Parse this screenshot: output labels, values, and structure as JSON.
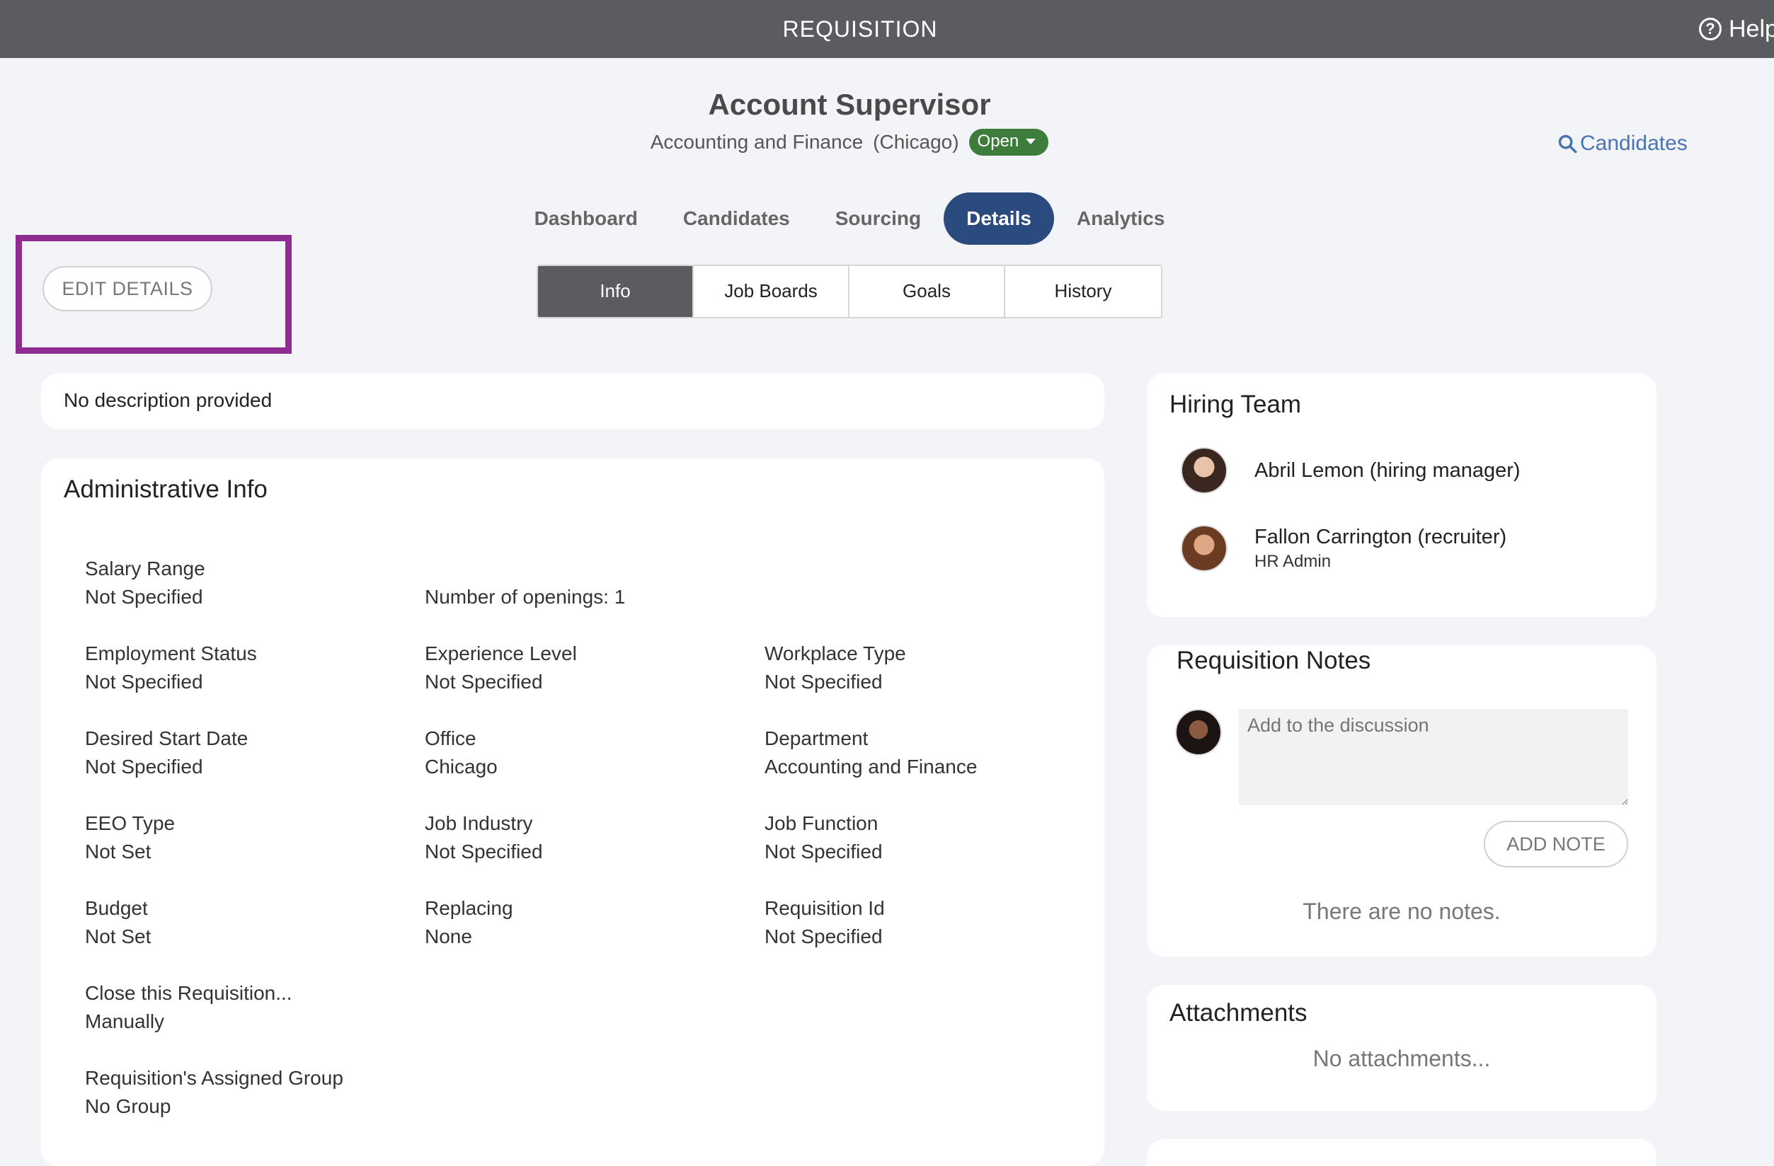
{
  "topbar": {
    "title": "REQUISITION",
    "help_label": "Help"
  },
  "header": {
    "title": "Account Supervisor",
    "department": "Accounting and Finance",
    "location": "(Chicago)",
    "status": "Open",
    "candidates_link": "Candidates"
  },
  "main_tabs": [
    "Dashboard",
    "Candidates",
    "Sourcing",
    "Details",
    "Analytics"
  ],
  "main_tabs_active": "Details",
  "sub_tabs": [
    "Info",
    "Job Boards",
    "Goals",
    "History"
  ],
  "sub_tabs_active": "Info",
  "edit_details_label": "EDIT DETAILS",
  "description": "No description provided",
  "admin": {
    "heading": "Administrative Info",
    "salary_label": "Salary Range",
    "salary_value": "Not Specified",
    "openings": "Number of openings: 1",
    "employment_label": "Employment Status",
    "employment_value": "Not Specified",
    "experience_label": "Experience Level",
    "experience_value": "Not Specified",
    "workplace_label": "Workplace Type",
    "workplace_value": "Not Specified",
    "start_label": "Desired Start Date",
    "start_value": "Not Specified",
    "office_label": "Office",
    "office_value": "Chicago",
    "dept_label": "Department",
    "dept_value": "Accounting and Finance",
    "eeo_label": "EEO Type",
    "eeo_value": "Not Set",
    "industry_label": "Job Industry",
    "industry_value": "Not Specified",
    "function_label": "Job Function",
    "function_value": "Not Specified",
    "budget_label": "Budget",
    "budget_value": "Not Set",
    "replacing_label": "Replacing",
    "replacing_value": "None",
    "reqid_label": "Requisition Id",
    "reqid_value": "Not Specified",
    "close_label": "Close this Requisition...",
    "close_value": "Manually",
    "group_label": "Requisition's Assigned Group",
    "group_value": "No Group"
  },
  "hiring_team": {
    "heading": "Hiring Team",
    "members": [
      {
        "name": "Abril Lemon (hiring manager)",
        "role": ""
      },
      {
        "name": "Fallon Carrington (recruiter)",
        "role": "HR Admin"
      }
    ]
  },
  "notes": {
    "heading": "Requisition Notes",
    "placeholder": "Add to the discussion",
    "add_label": "ADD NOTE",
    "empty": "There are no notes."
  },
  "attachments": {
    "heading": "Attachments",
    "empty": "No attachments..."
  }
}
